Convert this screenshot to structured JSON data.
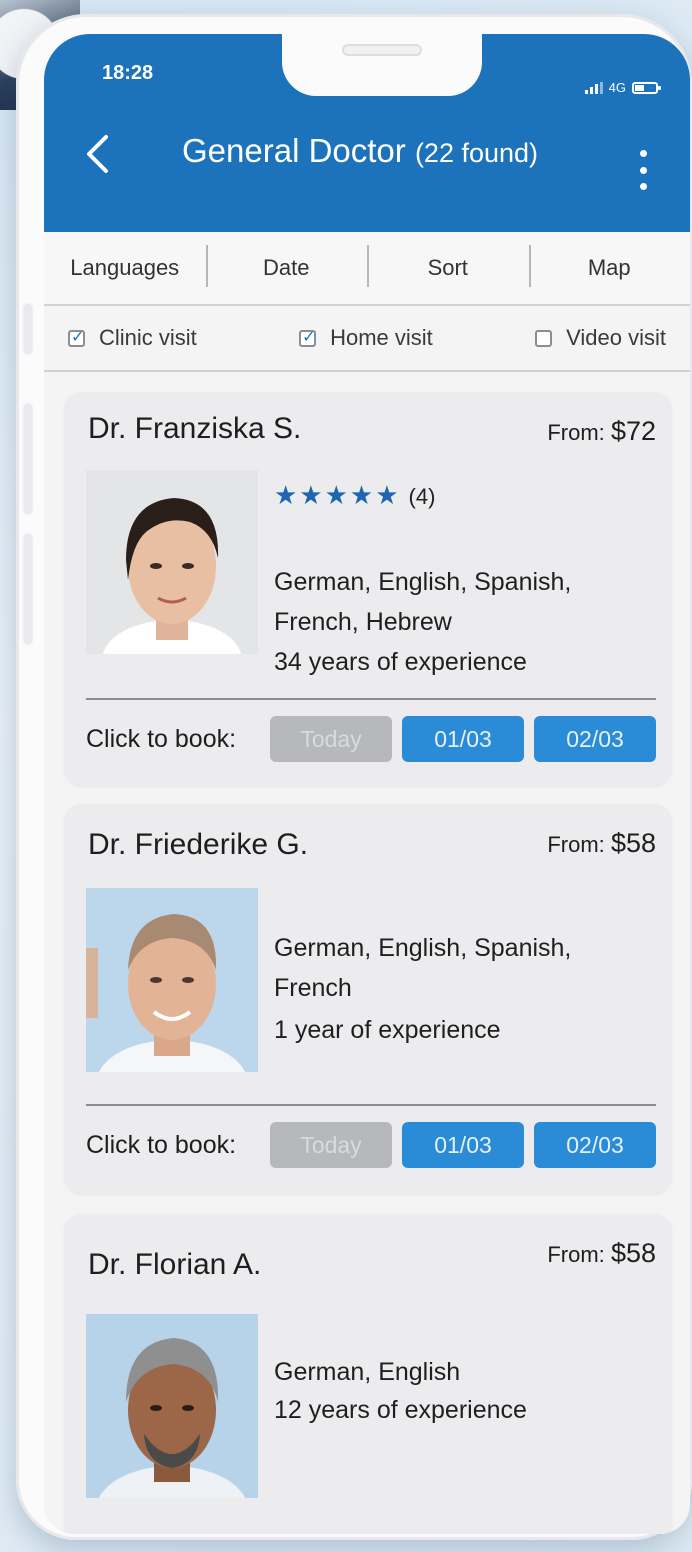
{
  "status_bar": {
    "time": "18:28",
    "network": "4G"
  },
  "header": {
    "title": "General Doctor",
    "found": "(22 found)"
  },
  "filters": [
    "Languages",
    "Date",
    "Sort",
    "Map"
  ],
  "visit_types": [
    {
      "label": "Clinic visit",
      "checked": true
    },
    {
      "label": "Home visit",
      "checked": true
    },
    {
      "label": "Video visit",
      "checked": false
    }
  ],
  "book_label": "Click to book:",
  "doctors": [
    {
      "name": "Dr. Franziska S.",
      "price_prefix": "From:",
      "price": "$72",
      "stars": "★★★★★",
      "rating_count": "(4)",
      "languages": "German, English, Spanish, French, Hebrew",
      "experience": "34 years of experience",
      "slots": [
        "Today",
        "01/03",
        "02/03"
      ]
    },
    {
      "name": "Dr. Friederike G.",
      "price_prefix": "From:",
      "price": "$58",
      "languages": "German, English, Spanish, French",
      "experience": "1 year of experience",
      "slots": [
        "Today",
        "01/03",
        "02/03"
      ]
    },
    {
      "name": "Dr. Florian A.",
      "price_prefix": "From:",
      "price": "$58",
      "languages": "German, English",
      "experience": "12 years of experience"
    }
  ],
  "colors": {
    "primary": "#1c73bb",
    "slot_active": "#2a8bd6",
    "slot_disabled": "#b7b8bb",
    "star": "#1e66b0"
  },
  "icons": [
    "back-arrow-icon",
    "more-vertical-icon",
    "signal-icon",
    "battery-icon",
    "checkbox-icon"
  ]
}
